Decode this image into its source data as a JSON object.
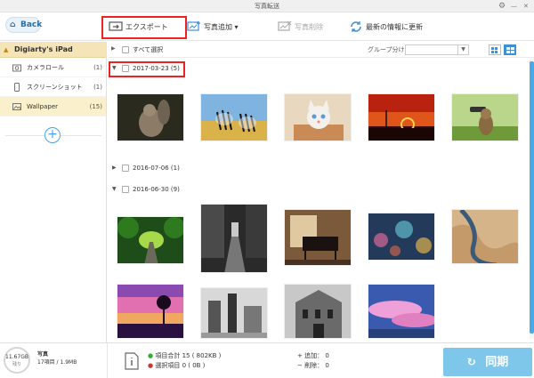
{
  "window": {
    "title": "写真転送",
    "gear": "⚙",
    "minimize": "—",
    "close": "✕"
  },
  "toolbar": {
    "back_label": "Back",
    "export_label": "エクスポート",
    "add_photo_label": "写真追加 ▾",
    "delete_photo_label": "写真削除",
    "refresh_label": "最新の情報に更新"
  },
  "sidebar": {
    "device_name": "Digiarty's iPad",
    "items": [
      {
        "label": "カメラロール",
        "count": "(1)",
        "icon": "camera-icon"
      },
      {
        "label": "スクリーンショット",
        "count": "(1)",
        "icon": "phone-icon"
      },
      {
        "label": "Wallpaper",
        "count": "(15)",
        "icon": "album-icon"
      }
    ],
    "add_symbol": "+"
  },
  "main": {
    "select_all_label": "すべて選択",
    "group_by_label": "グループ分け：",
    "group_select_value": "",
    "groups": [
      {
        "label": "2017-03-23 (5)",
        "expanded": true,
        "symbol": "▼"
      },
      {
        "label": "2016-07-06 (1)",
        "expanded": false,
        "symbol": "▶"
      },
      {
        "label": "2016-06-30 (9)",
        "expanded": true,
        "symbol": "▼"
      }
    ],
    "expand_arrow": "▶",
    "photos": [
      "squirrel",
      "zebras",
      "kitten",
      "eclipse-sunset",
      "owl-binoculars",
      "tree-tunnel",
      "dark-street",
      "piano",
      "rain-bokeh",
      "aerial-river",
      "pink-sunset-tree",
      "bw-monument",
      "bw-building",
      "pink-clouds"
    ]
  },
  "footer": {
    "capacity": "11.67GB",
    "capacity_sub": "残り",
    "category": "写真",
    "category_stats": "17項目 / 1.9MB",
    "total_label": "項目合計 15 ( 802KB )",
    "selected_label": "選択項目 0 ( 0B )",
    "add_label": "追加： 0",
    "delete_label": "削除： 0",
    "sync_label": "同期",
    "sync_icon": "↻",
    "bullet_green": "●",
    "bullet_red": "●",
    "plus_sign": "+",
    "minus_sign": "−"
  },
  "colors": {
    "accent": "#3d8fd6",
    "highlight": "#e22222",
    "sync": "#7ec7ea",
    "device_bar": "#f4e4b8"
  }
}
